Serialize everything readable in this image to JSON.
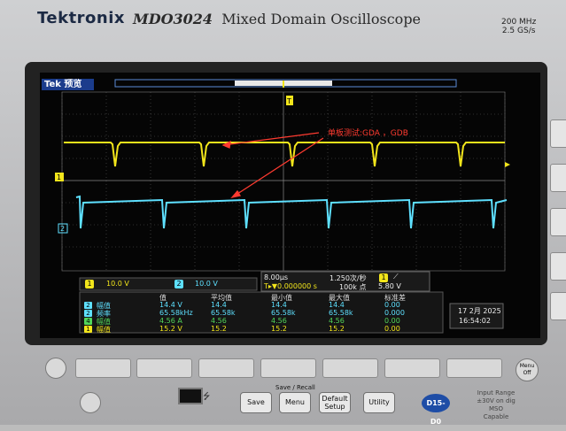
{
  "header": {
    "brand": "Tektronix",
    "model": "MDO3024",
    "model_desc": "Mixed Domain Oscilloscope",
    "spec_line1": "200 MHz",
    "spec_line2": "2.5 GS/s"
  },
  "screen": {
    "mode": "Tek 预览",
    "annotation": "单板测试:GDA ，GDB"
  },
  "status_bar": {
    "ch1_label": "1",
    "ch1_scale": "10.0 V",
    "ch2_label": "2",
    "ch2_scale": "10.0 V",
    "timebase": "8.00µs",
    "sample_rate": "1.250次/秒",
    "trigger_pos": "T▸▼0.000000 s",
    "record_length": "100k 点",
    "trigger_source": "1",
    "trigger_level": "5.80 V"
  },
  "measurements": {
    "headers": [
      "值",
      "平均值",
      "最小值",
      "最大值",
      "标准差"
    ],
    "rows": [
      {
        "ch": "2",
        "name": "幅值",
        "values": [
          "14.4 V",
          "14.4",
          "14.4",
          "14.4",
          "0.00"
        ],
        "color": "#5ee0ff"
      },
      {
        "ch": "2",
        "name": "频率",
        "values": [
          "65.58kHz",
          "65.58k",
          "65.58k",
          "65.58k",
          "0.000"
        ],
        "color": "#5ee0ff"
      },
      {
        "ch": "4",
        "name": "幅值",
        "values": [
          "4.56 A",
          "4.56",
          "4.56",
          "4.56",
          "0.00"
        ],
        "color": "#52d65a"
      },
      {
        "ch": "1",
        "name": "幅值",
        "values": [
          "15.2 V",
          "15.2",
          "15.2",
          "15.2",
          "0.00"
        ],
        "color": "#f2e51b"
      }
    ]
  },
  "datetime": {
    "date": "17 2月 2025",
    "time": "16:54:02"
  },
  "front_panel": {
    "save_recall_label": "Save / Recall",
    "save": "Save",
    "menu": "Menu",
    "default_setup_1": "Default",
    "default_setup_2": "Setup",
    "utility": "Utility",
    "d15_d0": "D15-D0",
    "mso_line1": "Input Range ±30V on dig",
    "mso_line2": "MSO",
    "mso_line3": "Capable",
    "menu_off_1": "Menu",
    "menu_off_2": "Off"
  },
  "colors": {
    "ch1": "#f2e51b",
    "ch2": "#5ee0ff",
    "ch4": "#52d65a",
    "annotation": "#ff3b30"
  }
}
